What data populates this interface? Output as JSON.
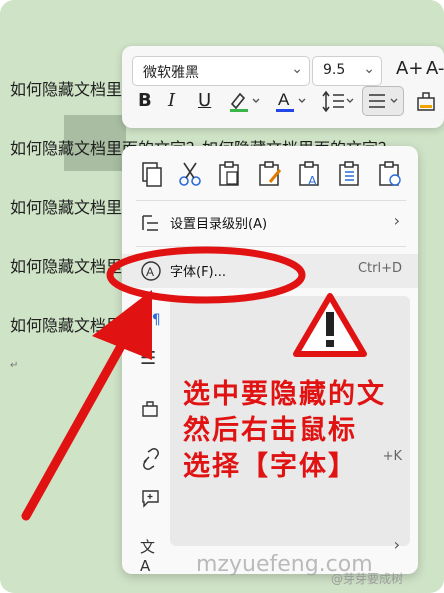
{
  "document": {
    "lines": [
      "如何隐藏文档里面的文字？如何隐藏文档里面的文字？",
      "如何隐藏文档里面的文字？如何隐藏文档里面的文字？",
      "如何隐藏文档里面的文字？如何隐藏文档里面的文字？",
      "如何隐藏文档里面的文字？如何隐藏文档里面的文字？",
      "如何隐藏文档里面的文字？如何隐藏文档里面的文字？"
    ],
    "paragraph_mark": "↵"
  },
  "toolbar": {
    "font_name": "微软雅黑",
    "font_size": "9.5",
    "grow_font_label": "A+",
    "shrink_font_label": "A-",
    "bold_label": "B",
    "italic_label": "I",
    "underline_label": "U",
    "font_color_label": "A"
  },
  "menu": {
    "items": [
      {
        "label": "设置目录级别(A)",
        "shortcut": "",
        "submenu": true
      },
      {
        "label": "字体(F)...",
        "shortcut": "Ctrl+D",
        "submenu": false
      }
    ],
    "visible_shortcut_lower": "+K"
  },
  "annotation": {
    "lines": [
      "选中要隐藏的文",
      "然后右击鼠标",
      "选择【字体】"
    ],
    "color": "#e11212"
  },
  "watermark": {
    "text": "mzyuefeng.com",
    "credit": "@芽芽要成树"
  }
}
